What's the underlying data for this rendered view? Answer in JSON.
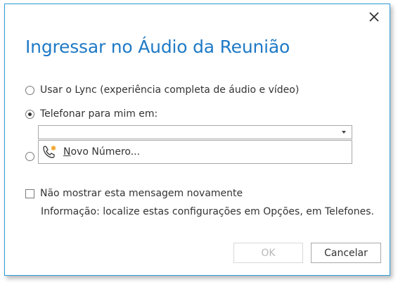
{
  "dialog": {
    "title": "Ingressar no Áudio da Reunião",
    "close_icon": "close-icon",
    "options": [
      {
        "label": "Usar o Lync (experiência completa de áudio e vídeo)",
        "checked": false
      },
      {
        "label": "Telefonar para mim em:",
        "checked": true
      }
    ],
    "phone_combo": {
      "value": "",
      "arrow_icon": "chevron-down-icon"
    },
    "dropdown_item": {
      "icon": "phone-add-icon",
      "label_first": "N",
      "label_rest": "ovo Número..."
    },
    "dont_show_label": "Não mostrar esta mensagem novamente",
    "info_text": "Informação: localize estas configurações em Opções, em Telefones.",
    "ok_label": "OK",
    "cancel_label": "Cancelar",
    "accent_color": "#1f7ac6",
    "border_color": "#2f9bd8"
  }
}
